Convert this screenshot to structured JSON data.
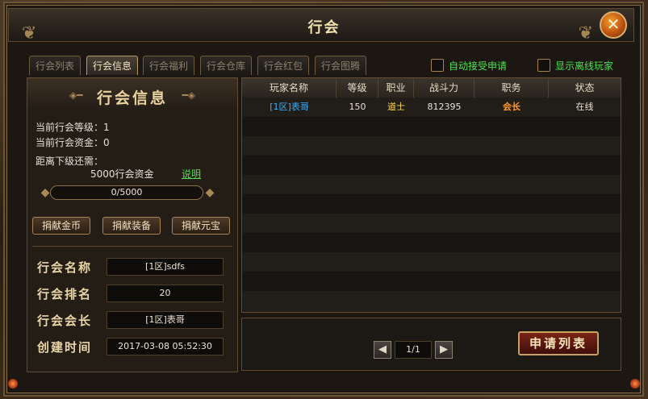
{
  "window": {
    "title": "行会"
  },
  "tabs": [
    {
      "label": "行会列表",
      "active": false
    },
    {
      "label": "行会信息",
      "active": true
    },
    {
      "label": "行会福利",
      "active": false
    },
    {
      "label": "行会仓库",
      "active": false
    },
    {
      "label": "行会红包",
      "active": false
    },
    {
      "label": "行会图腾",
      "active": false
    }
  ],
  "options": {
    "auto_accept": {
      "label": "自动接受申请",
      "checked": false
    },
    "show_offline": {
      "label": "显示离线玩家",
      "checked": false
    }
  },
  "guild_info": {
    "header": "行会信息",
    "level_line": "当前行会等级：1",
    "funds_line": "当前行会资金：0",
    "next_level_label": "距离下级还需：",
    "next_level_req": "5000行会资金",
    "explain_link": "说明",
    "progress": {
      "text": "0/5000",
      "fraction": 0
    },
    "buttons": {
      "donate_gold": "捐献金币",
      "donate_equip": "捐献装备",
      "donate_yuanbao": "捐献元宝"
    },
    "fields": [
      {
        "label": "行会名称",
        "value": "[1区]sdfs"
      },
      {
        "label": "行会排名",
        "value": "20"
      },
      {
        "label": "行会会长",
        "value": "[1区]表哥"
      },
      {
        "label": "创建时间",
        "value": "2017-03-08 05:52:30"
      }
    ]
  },
  "members_table": {
    "columns": [
      "玩家名称",
      "等级",
      "职业",
      "战斗力",
      "职务",
      "状态"
    ],
    "rows": [
      {
        "name": "[1区]表哥",
        "level": "150",
        "class": "道士",
        "power": "812395",
        "title": "会长",
        "status": "在线"
      }
    ],
    "colors": {
      "name": "#3ab0ff",
      "class": "#ffd84a",
      "title": "#ff9a2a",
      "default": "#e6e0d4"
    }
  },
  "pagination": {
    "prev": "◀",
    "next": "▶",
    "display": "1/1"
  },
  "apply_list_button": "申请列表"
}
